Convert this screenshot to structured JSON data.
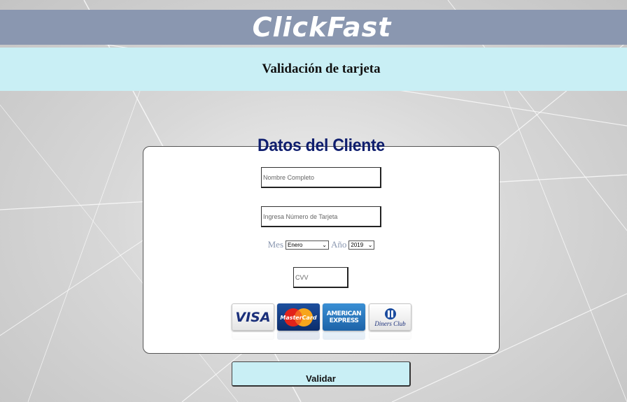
{
  "header": {
    "brand": "ClickFast",
    "subtitle": "Validación de tarjeta"
  },
  "form": {
    "title": "Datos del Cliente",
    "name_placeholder": "Nombre Completo",
    "card_placeholder": "Ingresa Número de Tarjeta",
    "month_label": "Mes",
    "month_value": "Enero",
    "year_label": "Año",
    "year_value": "2019",
    "cvv_placeholder": "CVV"
  },
  "card_logos": {
    "visa": "VISA",
    "mastercard": "MasterCard",
    "amex_line1": "AMERICAN",
    "amex_line2": "EXPRESS",
    "diners": "Diners Club"
  },
  "actions": {
    "validate_label": "Validar"
  },
  "colors": {
    "brand_bar": "#8a97b0",
    "subheader": "#c9eff5",
    "title": "#0f1e6e",
    "button": "#c9eff5"
  }
}
